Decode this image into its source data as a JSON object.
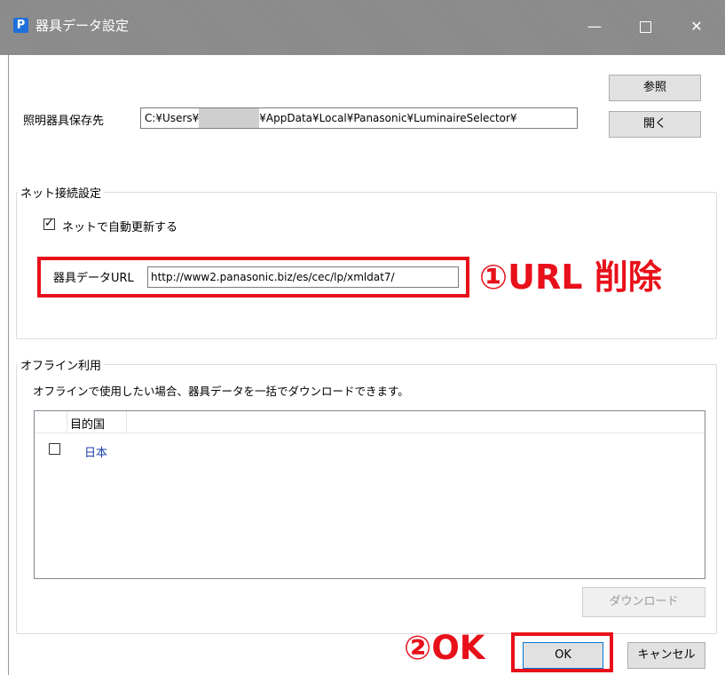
{
  "window": {
    "app_icon_letter": "P",
    "title": "器具データ設定",
    "controls": {
      "minimize": "—",
      "close": "✕"
    }
  },
  "storage": {
    "label": "照明器具保存先",
    "path_prefix": "C:¥Users¥",
    "path_suffix": "¥AppData¥Local¥Panasonic¥LuminaireSelector¥",
    "browse_label": "参照",
    "open_label": "開く"
  },
  "net": {
    "group_title": "ネット接続設定",
    "auto_update_label": "ネットで自動更新する",
    "auto_update_checked": true,
    "url_label": "器具データURL",
    "url_value": "http://www2.panasonic.biz/es/cec/lp/xmldat7/"
  },
  "offline": {
    "group_title": "オフライン利用",
    "description": "オフラインで使用したい場合、器具データを一括でダウンロードできます。",
    "list_header": "目的国",
    "rows": [
      {
        "label": "日本",
        "checked": false
      }
    ],
    "download_label": "ダウンロード"
  },
  "footer": {
    "ok_label": "OK",
    "cancel_label": "キャンセル"
  },
  "annotations": {
    "step1": "①URL 削除",
    "step2": "②OK",
    "color": "#e8101a"
  }
}
